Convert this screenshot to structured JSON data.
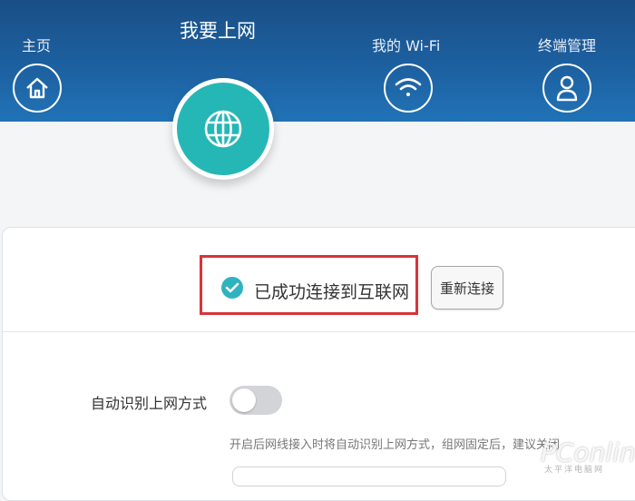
{
  "nav": {
    "home": {
      "label": "主页",
      "icon": "home-icon"
    },
    "internet": {
      "label": "我要上网",
      "icon": "globe-icon"
    },
    "wifi": {
      "label": "我的 Wi-Fi",
      "icon": "wifi-icon"
    },
    "terminal": {
      "label": "终端管理",
      "icon": "user-icon"
    }
  },
  "status": {
    "text": "已成功连接到互联网",
    "icon": "check-circle-icon",
    "reconnect_label": "重新连接"
  },
  "settings": {
    "auto_detect_label": "自动识别上网方式",
    "auto_detect_on": false,
    "hint": "开启后网线接入时将自动识别上网方式，组网固定后，建议关闭"
  },
  "watermark": {
    "brand": "PConline",
    "sub": "太平洋电脑网"
  },
  "colors": {
    "header": "#1d62a3",
    "accent": "#25b7b5",
    "highlight": "#d9333b"
  }
}
